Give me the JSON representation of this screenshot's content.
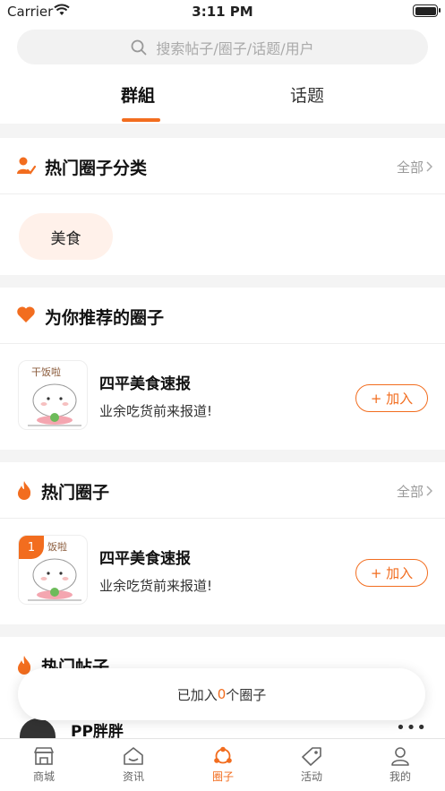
{
  "status_bar": {
    "carrier": "Carrier",
    "time": "3:11 PM"
  },
  "search": {
    "placeholder": "搜索帖子/圈子/话题/用户"
  },
  "tabs": [
    {
      "label": "群組",
      "active": true
    },
    {
      "label": "话题",
      "active": false
    }
  ],
  "hot_categories": {
    "title": "热门圈子分类",
    "more": "全部",
    "chips": [
      "美食"
    ]
  },
  "recommended": {
    "title": "为你推荐的圈子",
    "items": [
      {
        "name": "四平美食速报",
        "desc": "业余吃货前来报道!",
        "button": "+ 加入",
        "avatar_text": "干饭啦"
      }
    ]
  },
  "hot_circles": {
    "title": "热门圈子",
    "more": "全部",
    "items": [
      {
        "rank": "1",
        "name": "四平美食速报",
        "desc": "业余吃货前来报道!",
        "button": "+ 加入",
        "avatar_text": "饭啦"
      }
    ]
  },
  "hot_posts": {
    "title": "热门帖子",
    "user": "PP胖胖",
    "more": "•••"
  },
  "toast": {
    "prefix": "已加入",
    "count": "0",
    "suffix": "个圈子"
  },
  "tabbar": [
    {
      "label": "商城",
      "icon": "store-icon"
    },
    {
      "label": "资讯",
      "icon": "news-icon"
    },
    {
      "label": "圈子",
      "icon": "circle-icon",
      "active": true
    },
    {
      "label": "活动",
      "icon": "tag-icon"
    },
    {
      "label": "我的",
      "icon": "user-icon"
    }
  ],
  "colors": {
    "accent": "#f26d1f",
    "chip_bg": "#fff1ea"
  }
}
